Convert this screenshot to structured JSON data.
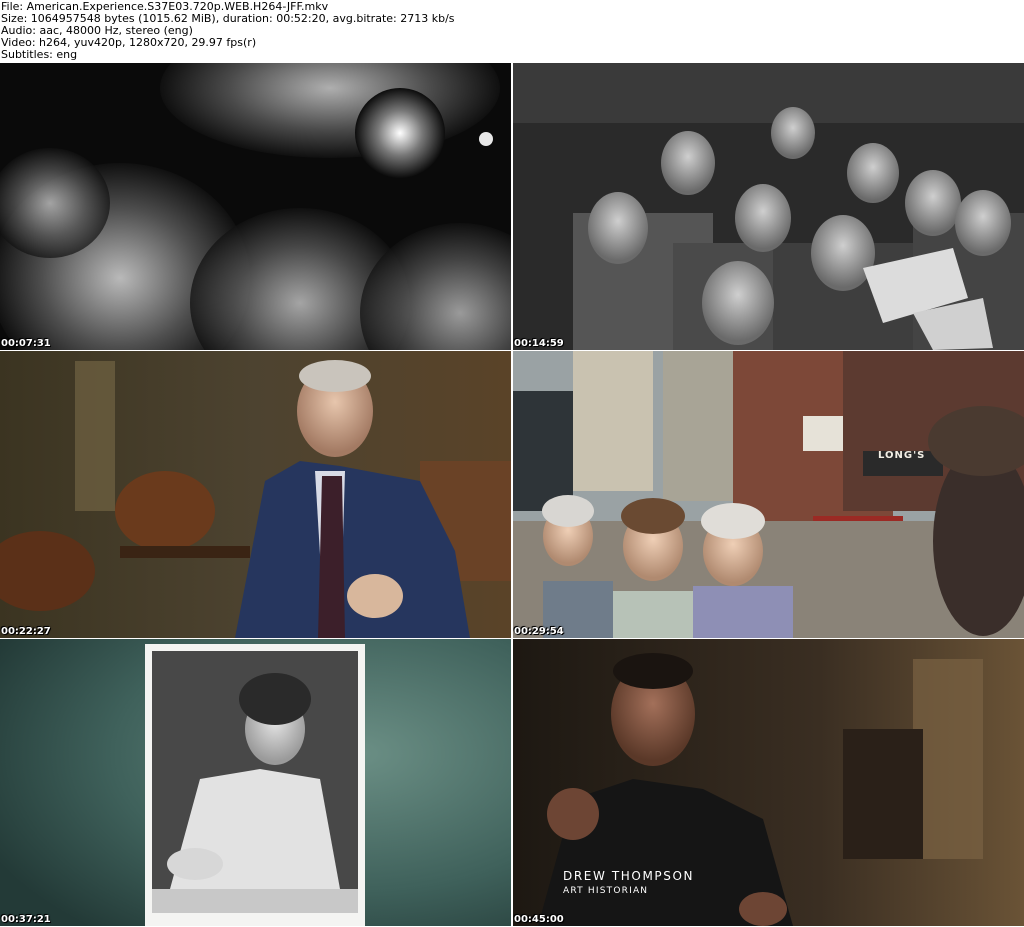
{
  "header": {
    "line1": "File: American.Experience.S37E03.720p.WEB.H264-JFF.mkv",
    "line2": "Size: 1064957548 bytes (1015.62 MiB), duration: 00:52:20, avg.bitrate: 2713 kb/s",
    "line3": "Audio: aac, 48000 Hz, stereo (eng)",
    "line4": "Video: h264, yuv420p, 1280x720, 29.97 fps(r)",
    "line5": "Subtitles: eng"
  },
  "thumbnails": [
    {
      "timestamp": "00:07:31"
    },
    {
      "timestamp": "00:14:59"
    },
    {
      "timestamp": "00:22:27"
    },
    {
      "timestamp": "00:29:54",
      "sign_text": "LONG'S"
    },
    {
      "timestamp": "00:37:21"
    },
    {
      "timestamp": "00:45:00",
      "caption_name": "DREW THOMPSON",
      "caption_role": "ART HISTORIAN"
    }
  ]
}
